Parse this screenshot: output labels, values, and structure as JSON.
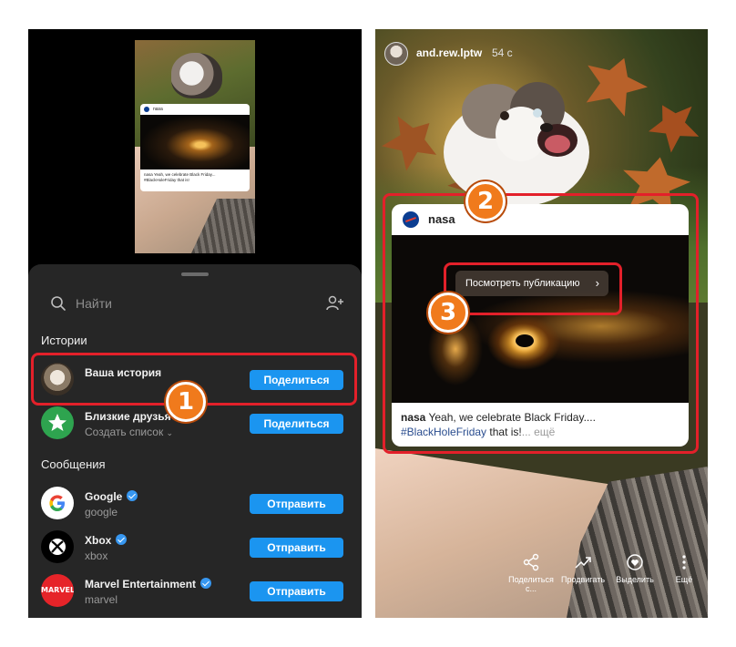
{
  "left_panel": {
    "thumbnail": {
      "post_author": "nasa",
      "caption": "nasa Yeah, we celebrate Black Friday... #BlackHoleFriday that is!"
    },
    "search": {
      "placeholder": "Найти"
    },
    "stories_section": {
      "title": "Истории",
      "items": [
        {
          "title": "Ваша история",
          "subtitle": "",
          "button": "Поделиться"
        },
        {
          "title": "Близкие друзья",
          "subtitle": "Создать список",
          "button": "Поделиться"
        }
      ]
    },
    "messages_section": {
      "title": "Сообщения",
      "items": [
        {
          "title": "Google",
          "subtitle": "google",
          "button": "Отправить",
          "verified": true
        },
        {
          "title": "Xbox",
          "subtitle": "xbox",
          "button": "Отправить",
          "verified": true
        },
        {
          "title": "Marvel Entertainment",
          "subtitle": "marvel",
          "button": "Отправить",
          "verified": true
        }
      ]
    },
    "marvel_logo_text": "MARVEL"
  },
  "right_panel": {
    "story": {
      "username": "and.rew.lptw",
      "time": "54 с"
    },
    "post": {
      "author": "nasa",
      "view_button": "Посмотреть публикацию",
      "caption_author": "nasa",
      "caption_text": " Yeah, we celebrate Black Friday....",
      "hashtag": "#BlackHoleFriday",
      "caption_tail": " that is!",
      "more": "... ещё"
    },
    "actions": [
      {
        "label": "Поделиться с...",
        "icon": "share-icon"
      },
      {
        "label": "Продвигать",
        "icon": "promote-icon"
      },
      {
        "label": "Выделить",
        "icon": "highlight-icon"
      },
      {
        "label": "Ещё",
        "icon": "more-icon"
      }
    ]
  },
  "annotations": {
    "badge_1": "1",
    "badge_2": "2",
    "badge_3": "3",
    "color": "#e3202a",
    "badge_color": "#f07a1c"
  }
}
